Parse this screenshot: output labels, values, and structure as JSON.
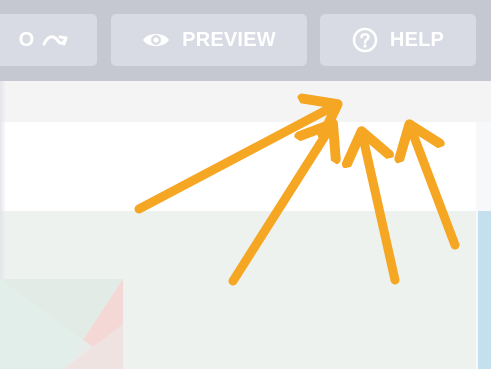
{
  "toolbar": {
    "redo_fragment": "O",
    "preview_label": "PREVIEW",
    "help_label": "HELP",
    "icons": {
      "redo": "redo-arrow-icon",
      "preview": "eye-icon",
      "help": "question-circle-icon"
    },
    "colors": {
      "toolbar_bg": "#c5c8d1",
      "button_bg": "#d8dbe3",
      "button_text": "#ffffff"
    }
  },
  "annotation": {
    "arrow_color": "#f5a623",
    "arrow_count": 4
  },
  "canvas": {
    "panel_color": "#edf2ef",
    "accent_strip_color": "#c4e0ef"
  }
}
